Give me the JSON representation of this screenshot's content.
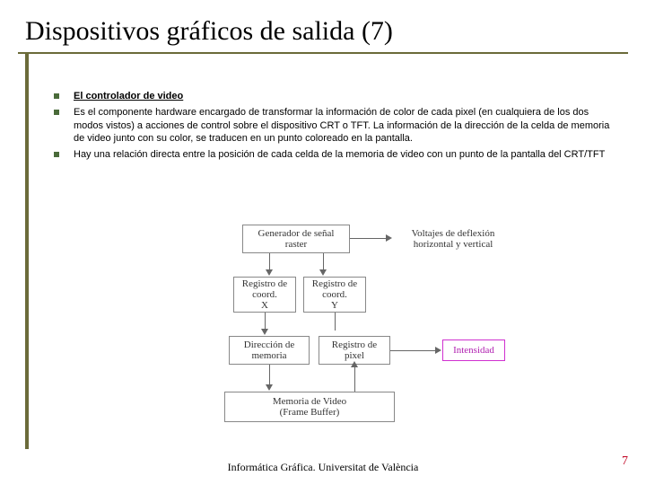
{
  "title": "Dispositivos gráficos de salida (7)",
  "bullets": [
    {
      "text": "El controlador de video",
      "underline": true
    },
    {
      "text": "Es el componente hardware encargado de transformar la información de color de cada pixel (en cualquiera de los dos modos vistos) a acciones de control sobre el dispositivo CRT o TFT. La información de la dirección de la celda de memoria de video junto con su color, se traducen en un punto coloreado en la pantalla.",
      "underline": false
    },
    {
      "text": "Hay una relación directa entre la posición de cada celda de la memoria de video con un punto de la pantalla del CRT/TFT",
      "underline": false
    }
  ],
  "diagram": {
    "gen": "Generador de señal\nraster",
    "deflex": "Voltajes de deflexión\nhorizontal y vertical",
    "regx": "Registro de\ncoord.\nX",
    "regy": "Registro de\ncoord.\nY",
    "dirmem": "Dirección de\nmemoria",
    "regpix": "Registro de\npixel",
    "intensidad": "Intensidad",
    "memvid": "Memoria de Video\n(Frame Buffer)"
  },
  "footer": "Informática Gráfica. Universitat de València",
  "page": "7"
}
